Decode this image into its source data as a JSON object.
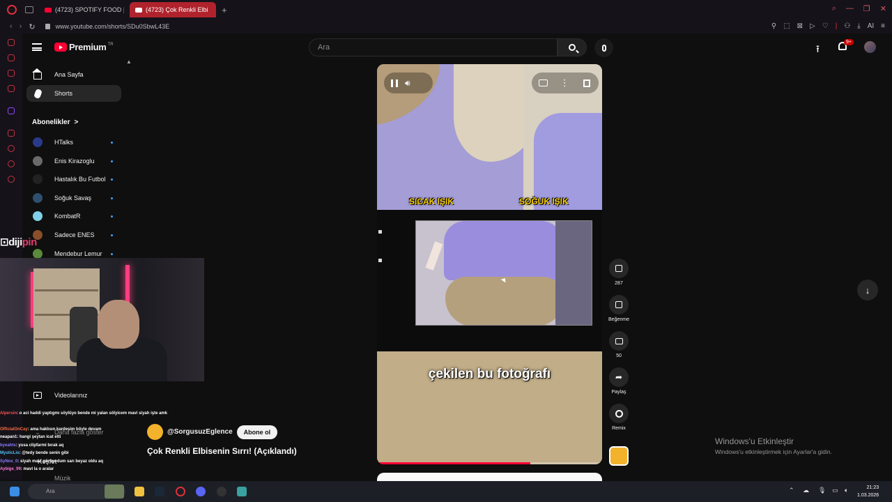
{
  "browser": {
    "tabs": [
      {
        "label": "(4723) SPOTIFY FOOD | M"
      },
      {
        "label": "(4723) Çok Renkli Elbi"
      }
    ],
    "new_tab": "+",
    "url": "www.youtube.com/shorts/SDu0SbwL43E",
    "ai_label": "AI"
  },
  "youtube": {
    "logo_text": "Premium",
    "logo_country": "TR",
    "search_placeholder": "Ara",
    "notification_badge": "9+"
  },
  "sidebar": {
    "home": "Ana Sayfa",
    "shorts": "Shorts",
    "subscriptions_header": "Abonelikler",
    "subscriptions_chevron": ">",
    "channels": [
      {
        "name": "HTalks",
        "color": "#2a3a8a"
      },
      {
        "name": "Enis Kirazoglu",
        "color": "#6a6a6a"
      },
      {
        "name": "Hastalık Bu Futbol",
        "color": "#111111"
      },
      {
        "name": "Soğuk Savaş",
        "color": "#2f4f6f"
      },
      {
        "name": "KombatR",
        "color": "#7fd0e8"
      },
      {
        "name": "Sadece ENES",
        "color": "#8a4f2a"
      },
      {
        "name": "Mendebur Lemur",
        "color": "#5a8a3a"
      }
    ],
    "your_videos": "Videolarınız",
    "show_more": "Daha fazla göster",
    "explore": "Keşfet",
    "music": "Müzik"
  },
  "overlay": {
    "brand_left": "diji",
    "brand_right": "pin"
  },
  "chat": [
    {
      "user": "Alpersin",
      "text": ": o aci haddi yaptıgmı söylüyo bende mi yalan sölyicem mavi siyah işte amk",
      "cls": "u1"
    },
    {
      "user": "OfficialOnCay",
      "text": ": ama haklısın kardeşim böyle devam",
      "cls": "u2"
    },
    {
      "user": "neapan1",
      "text": ": hangi şeytan icat etti",
      "cls": ""
    },
    {
      "user": "byeahts",
      "text": ": yusa clipfarmi bırak aq",
      "cls": "u3"
    },
    {
      "user": "MysticLio",
      "text": ": @tedy bende senin gibi",
      "cls": "u4"
    },
    {
      "user": "SyNox_0",
      "text": ": siyah mavi görüyodum sarı beyaz oldu aq",
      "cls": "u3"
    },
    {
      "user": "Aybige_99",
      "text": ": mavi la o aralar",
      "cls": "u5"
    }
  ],
  "short": {
    "caption_left": "SICAK IŞIK",
    "caption_right": "SOĞUK IŞIK",
    "subtitle": "çekilen bu fotoğrafı",
    "progress": 0.68,
    "channel_handle": "@SorgusuzEglence",
    "subscribe_label": "Abone ol",
    "title": "Çok Renkli Elbisenin Sırrı! (Açıklandı)"
  },
  "actions": {
    "likes": "287",
    "dislike_label": "Beğenme",
    "comments": "50",
    "share_label": "Paylaş",
    "remix_label": "Remix"
  },
  "windows": {
    "activate_title": "Windows'u Etkinleştir",
    "activate_sub": "Windows'u etkinleştirmek için Ayarlar'a gidin.",
    "search_label": "Ara",
    "time": "21:23",
    "date": "1.03.2026"
  }
}
